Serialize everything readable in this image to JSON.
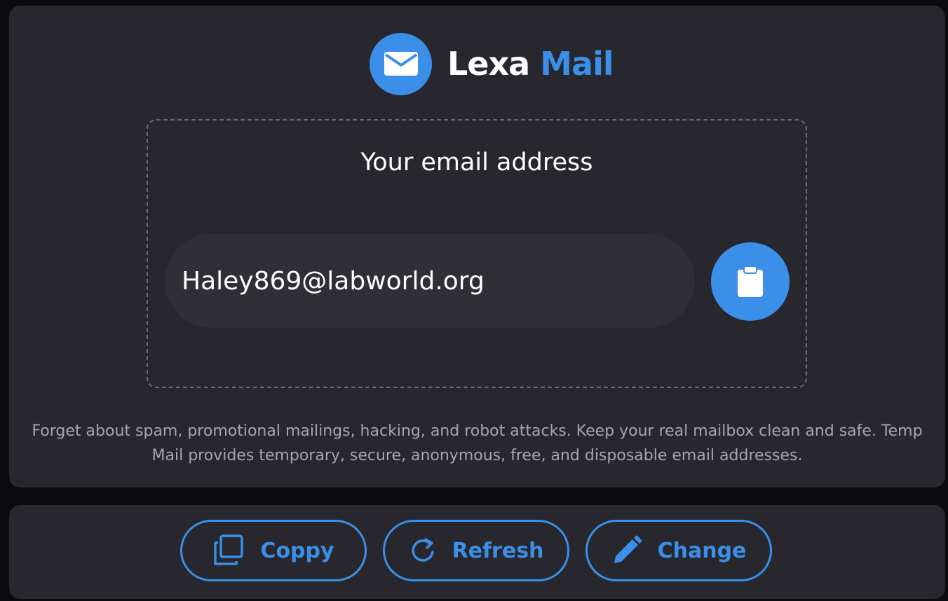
{
  "brand": {
    "name_part1": "Lexa",
    "name_part2": "Mail",
    "logo_icon": "envelope-icon"
  },
  "address_box": {
    "title": "Your email address",
    "email": "Haley869@labworld.org",
    "copy_icon": "clipboard-icon"
  },
  "tagline": "Forget about spam, promotional mailings, hacking, and robot attacks. Keep your real mailbox clean and safe. Temp Mail provides temporary, secure, anonymous, free, and disposable email addresses.",
  "actions": [
    {
      "label": "Coppy",
      "icon": "copy-icon"
    },
    {
      "label": "Refresh",
      "icon": "refresh-icon"
    },
    {
      "label": "Change",
      "icon": "pencil-icon"
    }
  ],
  "colors": {
    "accent": "#3b8fe8",
    "panel": "#27272d",
    "background": "#0b0b0d",
    "field": "#2f2f35"
  }
}
